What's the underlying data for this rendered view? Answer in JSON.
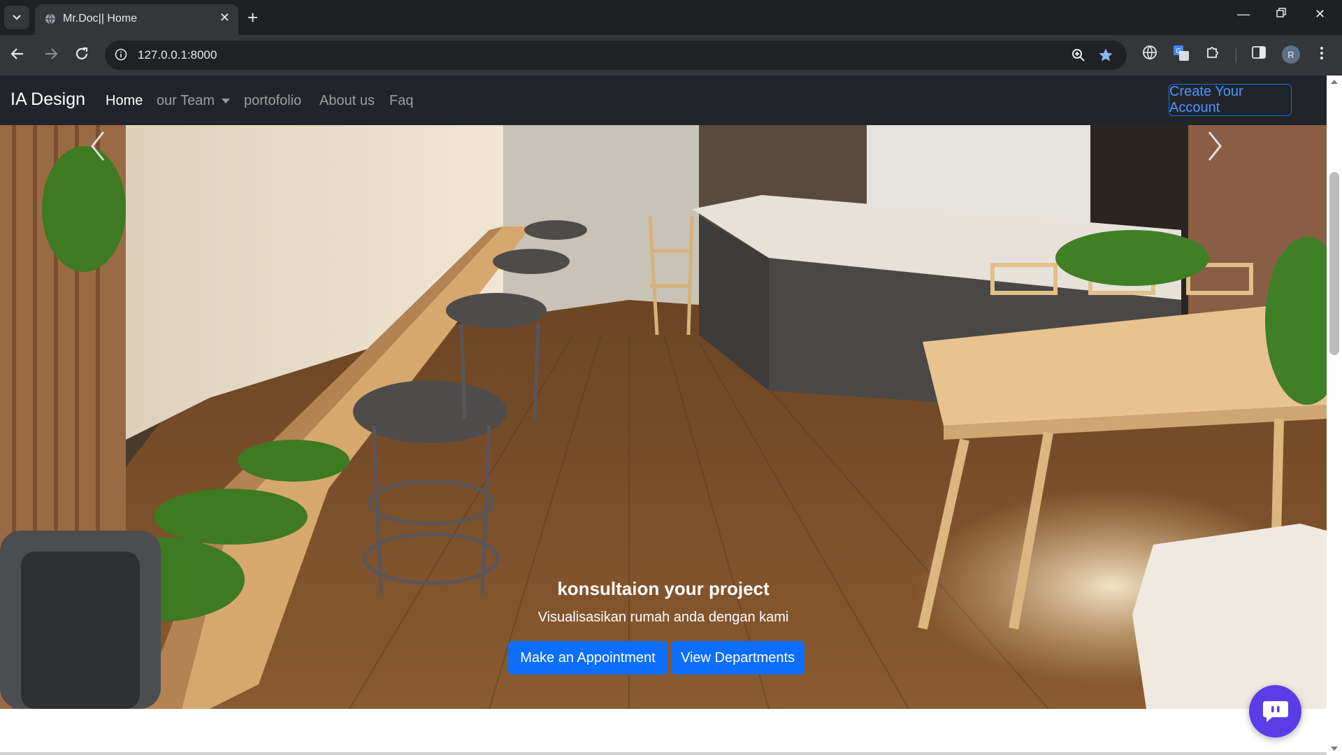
{
  "browser": {
    "tab_title": "Mr.Doc|| Home",
    "url": "127.0.0.1:8000",
    "profile_initial": "R"
  },
  "navbar": {
    "brand": "IA Design",
    "links": [
      {
        "label": "Home",
        "active": true
      },
      {
        "label": "our Team",
        "dropdown": true
      },
      {
        "label": "portofolio"
      },
      {
        "label": "About us"
      },
      {
        "label": "Faq"
      }
    ],
    "cta": "Create Your Account"
  },
  "hero": {
    "title": "konsultaion your project",
    "subtitle": "Visualisasikan rumah anda dengan kami",
    "buttons": [
      "Make an Appointment",
      "View Departments"
    ]
  },
  "colors": {
    "primary": "#0d6efd",
    "navbar_bg": "#212529",
    "chat_bubble": "#5b3de8"
  },
  "icons": [
    "tab-search-icon",
    "globe-icon",
    "close-icon",
    "plus-icon",
    "minimize-icon",
    "restore-icon",
    "back-icon",
    "forward-icon",
    "reload-icon",
    "info-icon",
    "zoom-icon",
    "star-icon",
    "translate-icon",
    "extensions-icon",
    "sidepanel-icon",
    "avatar",
    "kebab-menu-icon",
    "chevron-left-icon",
    "chevron-right-icon",
    "chat-icon"
  ]
}
